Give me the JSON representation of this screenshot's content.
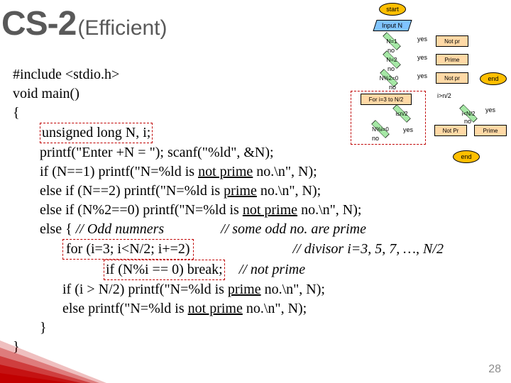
{
  "title": {
    "main": "CS-2",
    "sub": "(Efficient)"
  },
  "flow": {
    "start": "start",
    "input": "Input N",
    "d1": "N=1",
    "r1": "Not pr",
    "d2": "N=2",
    "r2": "Prime",
    "d3": "N%2=0",
    "r3": "Not pr",
    "loop": "For i=3 to N/2",
    "d4": "N%i=0",
    "d5": "i≤n/2",
    "d6": "i>n/2",
    "d7": "i<N/2",
    "r4": "Not Pr",
    "r5": "Prime",
    "end1": "end",
    "end2": "end",
    "yes": "yes",
    "no": "no"
  },
  "code": {
    "l1": "#include <stdio.h>",
    "l2": "void main()",
    "l3": "{",
    "l4a": "unsigned long  N, i;",
    "l5a": "printf(\"Enter +N = \"); scanf(\"%ld\", &N);",
    "l6": "if (N==1) printf(\"N=%ld is ",
    "l6b": "not prime",
    "l6c": " no.\\n\", N);",
    "l7": "else if (N==2) printf(\"N=%ld is ",
    "l7b": "prime",
    "l7c": " no.\\n\", N);",
    "l8": "else if (N%2==0) printf(\"N=%ld is ",
    "l8b": "not prime",
    "l8c": " no.\\n\", N);",
    "l9a": "else { ",
    "l9b": "// Odd numners",
    "l9c": "// some odd no. are prime",
    "l10a": "for (i=3; i<N/2; i+=2)",
    "l10b": "// divisor i=3, 5, 7, …, N/2",
    "l11": "if (N%i == 0) break;",
    "l11b": "// not prime",
    "l12": "if (i > N/2) printf(\"N=%ld is ",
    "l12b": "prime",
    "l12c": " no.\\n\", N);",
    "l13": "else           printf(\"N=%ld is ",
    "l13b": "not prime",
    "l13c": " no.\\n\", N);",
    "l14": "}",
    "l15": "}"
  },
  "pagenum": "28"
}
